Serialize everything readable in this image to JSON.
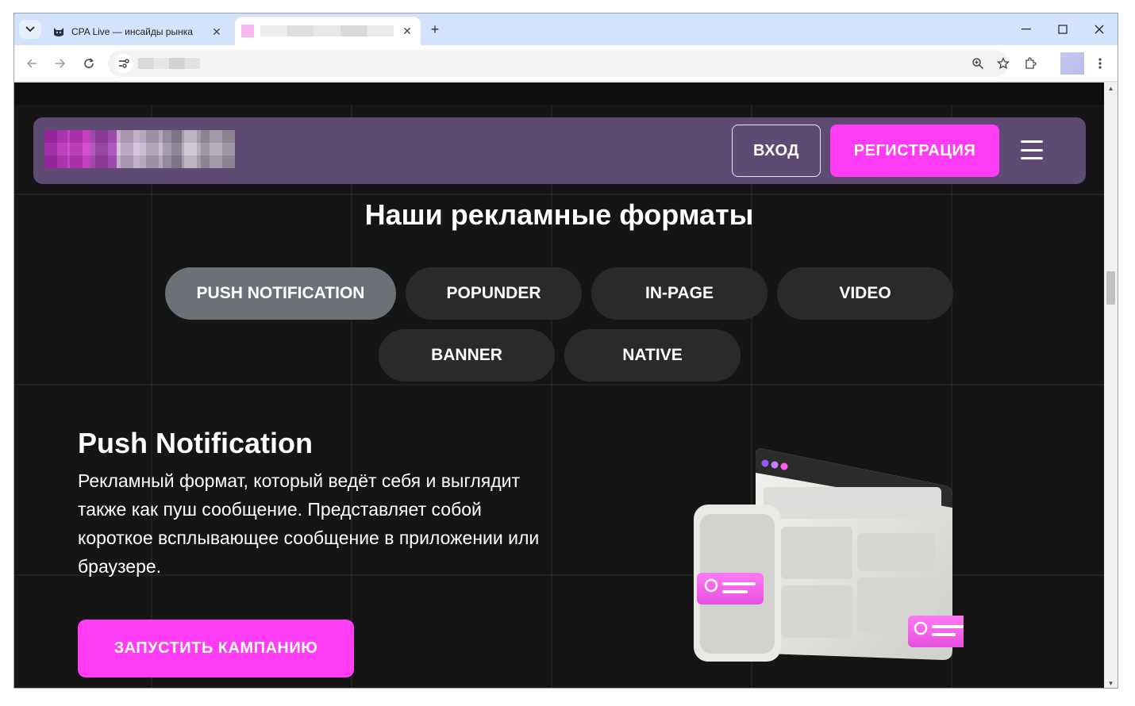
{
  "browser": {
    "tabs": [
      {
        "title": "CPA Live — инсайды рынка",
        "active": false
      },
      {
        "title": "",
        "active": true
      }
    ],
    "address": ""
  },
  "header": {
    "login_label": "ВХОД",
    "register_label": "РЕГИСТРАЦИЯ"
  },
  "main": {
    "heading": "Наши рекламные форматы",
    "formats": [
      {
        "label": "PUSH NOTIFICATION",
        "active": true
      },
      {
        "label": "POPUNDER",
        "active": false
      },
      {
        "label": "IN-PAGE",
        "active": false
      },
      {
        "label": "VIDEO",
        "active": false
      },
      {
        "label": "BANNER",
        "active": false
      },
      {
        "label": "NATIVE",
        "active": false
      }
    ],
    "feature": {
      "title": "Push Notification",
      "description": "Рекламный формат, который ведёт себя и выглядит также как пуш сообщение. Представляет собой короткое всплывающее сообщение в приложении или браузере.",
      "cta_label": "ЗАПУСТИТЬ КАМПАНИЮ"
    }
  },
  "colors": {
    "accent": "#ff3cf3",
    "header_bg": "#5f4a74",
    "page_bg": "#151515",
    "pill_bg": "#2a2a2a",
    "pill_active_bg": "#6c7077"
  }
}
